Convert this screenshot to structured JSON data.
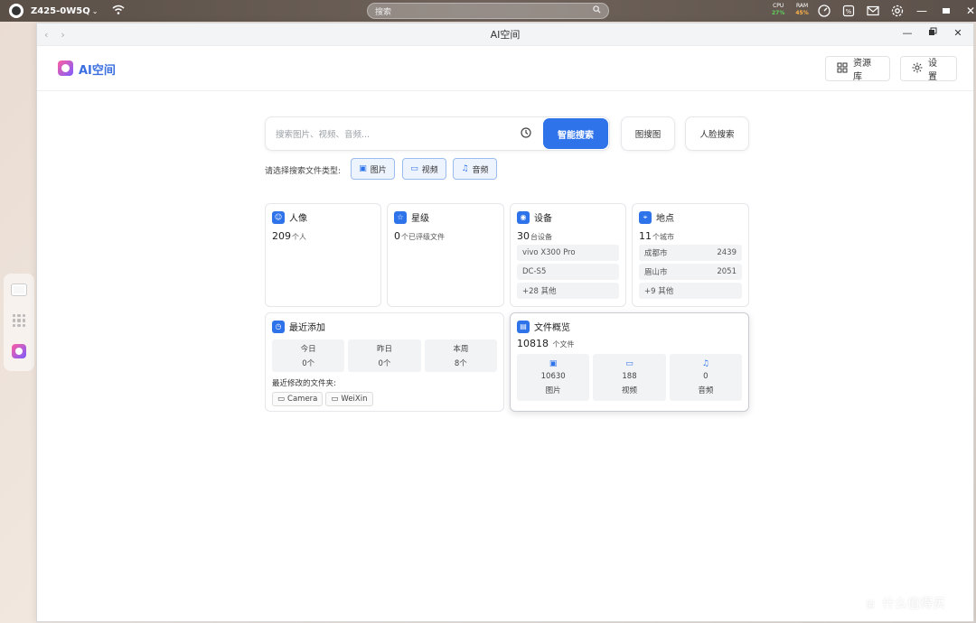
{
  "system": {
    "device_name": "Z425-0W5Q",
    "search_placeholder": "搜索",
    "cpu_label": "CPU",
    "cpu_value": "27%",
    "ram_label": "RAM",
    "ram_value": "45%"
  },
  "window": {
    "title": "AI空间"
  },
  "header": {
    "app_name": "AI空间",
    "library_label": "资源库",
    "settings_label": "设置"
  },
  "search": {
    "placeholder": "搜索图片、视频、音频...",
    "smart_search_label": "智能搜索",
    "image_search_label": "图搜图",
    "face_search_label": "人脸搜索",
    "type_prompt": "请选择搜索文件类型:",
    "types": [
      "图片",
      "视频",
      "音频"
    ]
  },
  "cards": {
    "people": {
      "title": "人像",
      "count": "209",
      "unit": "个人"
    },
    "stars": {
      "title": "星级",
      "count": "0",
      "unit": "个已评级文件"
    },
    "device": {
      "title": "设备",
      "count": "30",
      "unit": "台设备",
      "items": [
        "vivo X300 Pro",
        "DC-S5",
        "+28 其他"
      ]
    },
    "place": {
      "title": "地点",
      "count": "11",
      "unit": "个城市",
      "items": [
        {
          "name": "成都市",
          "value": "2439"
        },
        {
          "name": "眉山市",
          "value": "2051"
        },
        {
          "name": "+9 其他",
          "value": ""
        }
      ]
    },
    "recent": {
      "title": "最近添加",
      "stats": [
        {
          "label": "今日",
          "value": "0个"
        },
        {
          "label": "昨日",
          "value": "0个"
        },
        {
          "label": "本周",
          "value": "8个"
        }
      ],
      "folder_label": "最近修改的文件夹:",
      "folders": [
        "Camera",
        "WeiXin"
      ]
    },
    "files": {
      "title": "文件概览",
      "count": "10818",
      "unit": "个文件",
      "stats": [
        {
          "value": "10630",
          "label": "图片"
        },
        {
          "value": "188",
          "label": "视频"
        },
        {
          "value": "0",
          "label": "音频"
        }
      ]
    }
  },
  "watermark": "什么值得买",
  "colors": {
    "accent": "#2f73ea",
    "title_blue": "#3b6fe0"
  }
}
